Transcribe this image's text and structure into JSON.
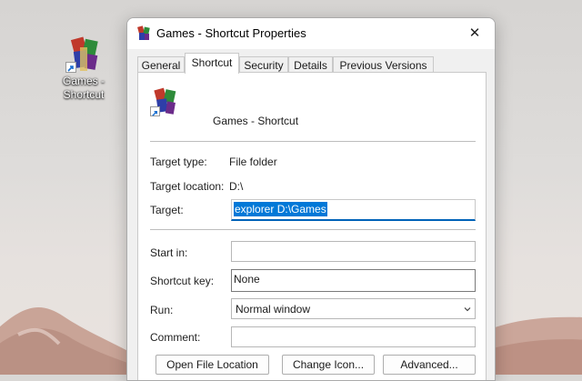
{
  "desktop": {
    "icon_label_line1": "Games -",
    "icon_label_line2": "Shortcut"
  },
  "dialog": {
    "title": "Games - Shortcut Properties",
    "close_glyph": "✕",
    "tabs": [
      "General",
      "Shortcut",
      "Security",
      "Details",
      "Previous Versions"
    ],
    "active_tab": "Shortcut",
    "shortcut_name": "Games - Shortcut",
    "target_type_label": "Target type:",
    "target_type_value": "File folder",
    "target_location_label": "Target location:",
    "target_location_value": "D:\\",
    "target_label": "Target:",
    "target_value": "explorer D:\\Games",
    "start_in_label": "Start in:",
    "start_in_value": "",
    "shortcut_key_label": "Shortcut key:",
    "shortcut_key_value": "None",
    "run_label": "Run:",
    "run_value": "Normal window",
    "comment_label": "Comment:",
    "comment_value": "",
    "buttons": {
      "open_location": "Open File Location",
      "change_icon": "Change Icon...",
      "advanced": "Advanced..."
    }
  },
  "icons": [
    "winrar-icon",
    "shortcut-arrow-icon",
    "close-icon",
    "chevron-down-icon"
  ]
}
